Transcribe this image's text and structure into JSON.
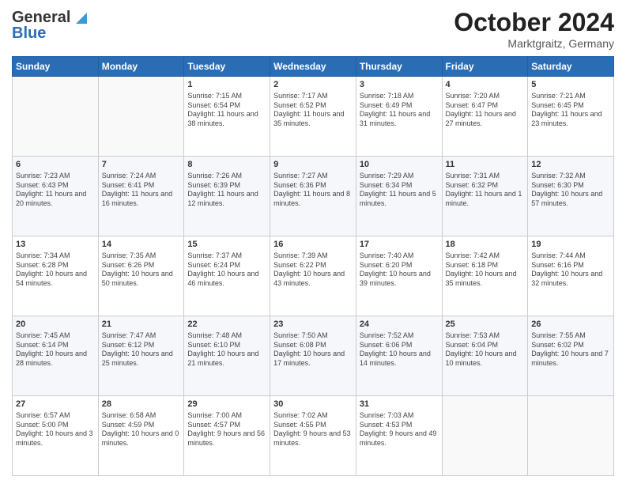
{
  "header": {
    "logo_line1": "General",
    "logo_line2": "Blue",
    "month": "October 2024",
    "location": "Marktgraitz, Germany"
  },
  "days_of_week": [
    "Sunday",
    "Monday",
    "Tuesday",
    "Wednesday",
    "Thursday",
    "Friday",
    "Saturday"
  ],
  "weeks": [
    [
      {
        "day": "",
        "info": ""
      },
      {
        "day": "",
        "info": ""
      },
      {
        "day": "1",
        "info": "Sunrise: 7:15 AM\nSunset: 6:54 PM\nDaylight: 11 hours and 38 minutes."
      },
      {
        "day": "2",
        "info": "Sunrise: 7:17 AM\nSunset: 6:52 PM\nDaylight: 11 hours and 35 minutes."
      },
      {
        "day": "3",
        "info": "Sunrise: 7:18 AM\nSunset: 6:49 PM\nDaylight: 11 hours and 31 minutes."
      },
      {
        "day": "4",
        "info": "Sunrise: 7:20 AM\nSunset: 6:47 PM\nDaylight: 11 hours and 27 minutes."
      },
      {
        "day": "5",
        "info": "Sunrise: 7:21 AM\nSunset: 6:45 PM\nDaylight: 11 hours and 23 minutes."
      }
    ],
    [
      {
        "day": "6",
        "info": "Sunrise: 7:23 AM\nSunset: 6:43 PM\nDaylight: 11 hours and 20 minutes."
      },
      {
        "day": "7",
        "info": "Sunrise: 7:24 AM\nSunset: 6:41 PM\nDaylight: 11 hours and 16 minutes."
      },
      {
        "day": "8",
        "info": "Sunrise: 7:26 AM\nSunset: 6:39 PM\nDaylight: 11 hours and 12 minutes."
      },
      {
        "day": "9",
        "info": "Sunrise: 7:27 AM\nSunset: 6:36 PM\nDaylight: 11 hours and 8 minutes."
      },
      {
        "day": "10",
        "info": "Sunrise: 7:29 AM\nSunset: 6:34 PM\nDaylight: 11 hours and 5 minutes."
      },
      {
        "day": "11",
        "info": "Sunrise: 7:31 AM\nSunset: 6:32 PM\nDaylight: 11 hours and 1 minute."
      },
      {
        "day": "12",
        "info": "Sunrise: 7:32 AM\nSunset: 6:30 PM\nDaylight: 10 hours and 57 minutes."
      }
    ],
    [
      {
        "day": "13",
        "info": "Sunrise: 7:34 AM\nSunset: 6:28 PM\nDaylight: 10 hours and 54 minutes."
      },
      {
        "day": "14",
        "info": "Sunrise: 7:35 AM\nSunset: 6:26 PM\nDaylight: 10 hours and 50 minutes."
      },
      {
        "day": "15",
        "info": "Sunrise: 7:37 AM\nSunset: 6:24 PM\nDaylight: 10 hours and 46 minutes."
      },
      {
        "day": "16",
        "info": "Sunrise: 7:39 AM\nSunset: 6:22 PM\nDaylight: 10 hours and 43 minutes."
      },
      {
        "day": "17",
        "info": "Sunrise: 7:40 AM\nSunset: 6:20 PM\nDaylight: 10 hours and 39 minutes."
      },
      {
        "day": "18",
        "info": "Sunrise: 7:42 AM\nSunset: 6:18 PM\nDaylight: 10 hours and 35 minutes."
      },
      {
        "day": "19",
        "info": "Sunrise: 7:44 AM\nSunset: 6:16 PM\nDaylight: 10 hours and 32 minutes."
      }
    ],
    [
      {
        "day": "20",
        "info": "Sunrise: 7:45 AM\nSunset: 6:14 PM\nDaylight: 10 hours and 28 minutes."
      },
      {
        "day": "21",
        "info": "Sunrise: 7:47 AM\nSunset: 6:12 PM\nDaylight: 10 hours and 25 minutes."
      },
      {
        "day": "22",
        "info": "Sunrise: 7:48 AM\nSunset: 6:10 PM\nDaylight: 10 hours and 21 minutes."
      },
      {
        "day": "23",
        "info": "Sunrise: 7:50 AM\nSunset: 6:08 PM\nDaylight: 10 hours and 17 minutes."
      },
      {
        "day": "24",
        "info": "Sunrise: 7:52 AM\nSunset: 6:06 PM\nDaylight: 10 hours and 14 minutes."
      },
      {
        "day": "25",
        "info": "Sunrise: 7:53 AM\nSunset: 6:04 PM\nDaylight: 10 hours and 10 minutes."
      },
      {
        "day": "26",
        "info": "Sunrise: 7:55 AM\nSunset: 6:02 PM\nDaylight: 10 hours and 7 minutes."
      }
    ],
    [
      {
        "day": "27",
        "info": "Sunrise: 6:57 AM\nSunset: 5:00 PM\nDaylight: 10 hours and 3 minutes."
      },
      {
        "day": "28",
        "info": "Sunrise: 6:58 AM\nSunset: 4:59 PM\nDaylight: 10 hours and 0 minutes."
      },
      {
        "day": "29",
        "info": "Sunrise: 7:00 AM\nSunset: 4:57 PM\nDaylight: 9 hours and 56 minutes."
      },
      {
        "day": "30",
        "info": "Sunrise: 7:02 AM\nSunset: 4:55 PM\nDaylight: 9 hours and 53 minutes."
      },
      {
        "day": "31",
        "info": "Sunrise: 7:03 AM\nSunset: 4:53 PM\nDaylight: 9 hours and 49 minutes."
      },
      {
        "day": "",
        "info": ""
      },
      {
        "day": "",
        "info": ""
      }
    ]
  ]
}
